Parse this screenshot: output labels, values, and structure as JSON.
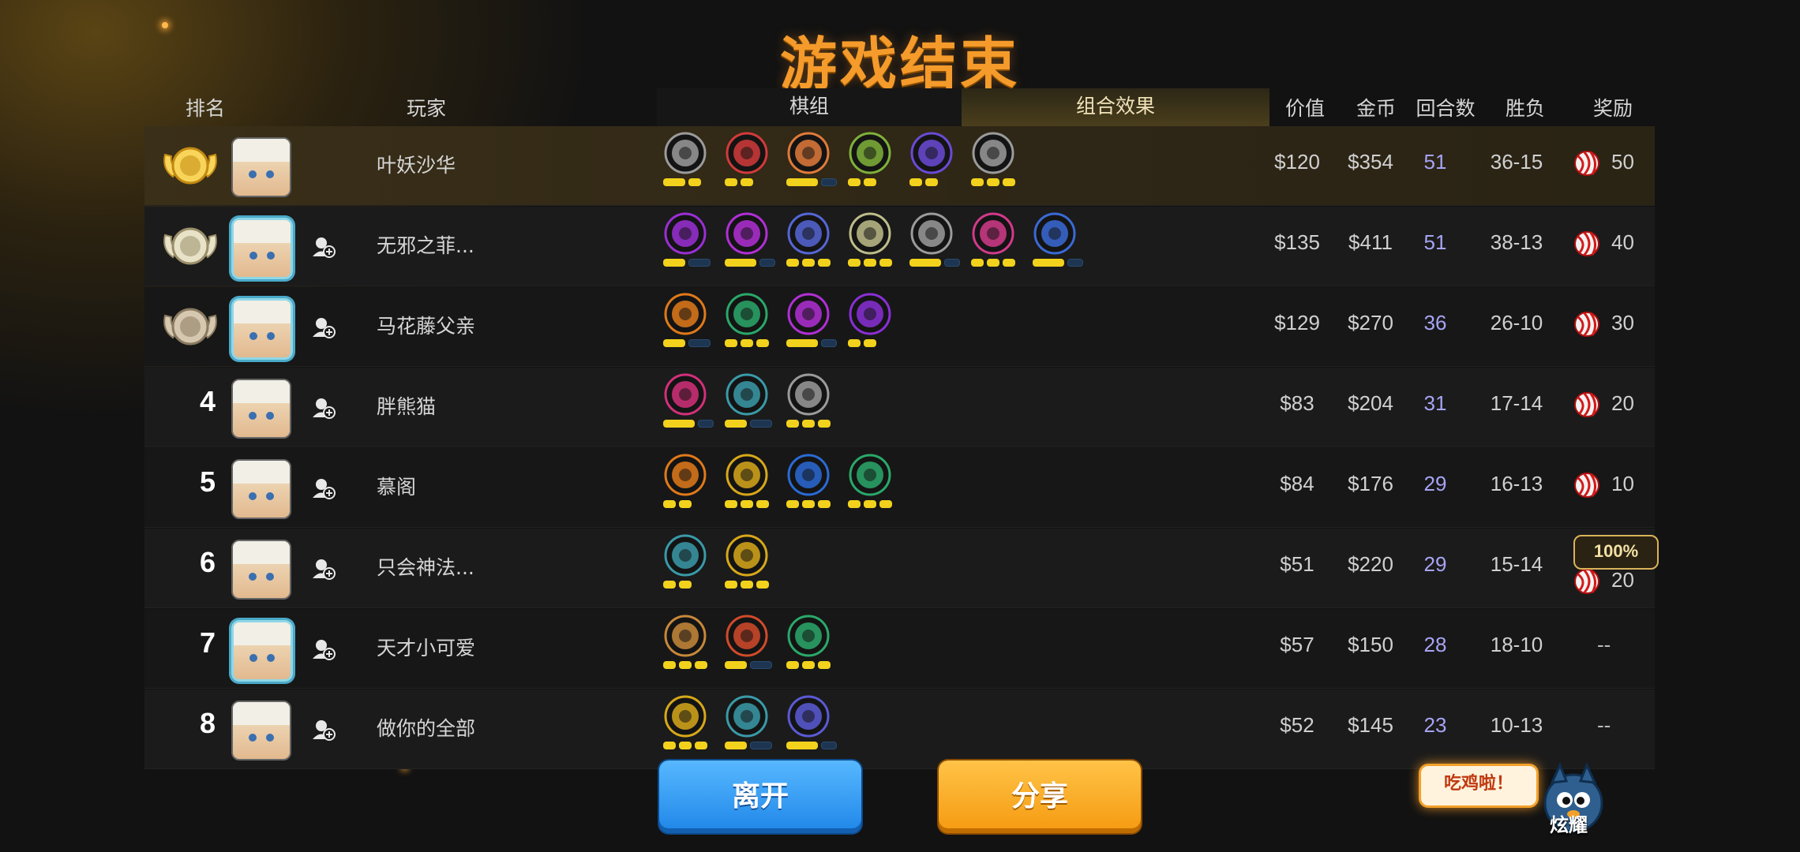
{
  "title": "游戏结束",
  "headers": {
    "rank": "排名",
    "player": "玩家",
    "lineup": "棋组",
    "synergy": "组合效果",
    "value": "价值",
    "gold": "金币",
    "rounds": "回合数",
    "record": "胜负",
    "reward": "奖励"
  },
  "players": [
    {
      "rank": "",
      "medal": "gold",
      "name": "叶妖沙华",
      "value": "$120",
      "gold": "$354",
      "rounds": "51",
      "record": "36-15",
      "reward": "50",
      "bonus": "",
      "units": [
        {
          "color": "#9b9b9b",
          "stars": [
            2,
            1
          ]
        },
        {
          "color": "#d23a3a",
          "stars": [
            1,
            1
          ]
        },
        {
          "color": "#e07a3a",
          "stars": [
            3,
            0
          ]
        },
        {
          "color": "#7fb13a",
          "stars": [
            1,
            1
          ]
        },
        {
          "color": "#6a4ad6",
          "stars": [
            1,
            1
          ]
        },
        {
          "color": "#9b9b9b",
          "stars": [
            1,
            1,
            1
          ]
        }
      ]
    },
    {
      "rank": "",
      "medal": "silver",
      "name": "无邪之菲...",
      "value": "$135",
      "gold": "$411",
      "rounds": "51",
      "record": "38-13",
      "reward": "40",
      "bonus": "",
      "units": [
        {
          "color": "#9b2fd6",
          "stars": [
            2,
            0
          ]
        },
        {
          "color": "#b12fd6",
          "stars": [
            3,
            0
          ]
        },
        {
          "color": "#5566d6",
          "stars": [
            1,
            1,
            1
          ]
        },
        {
          "color": "#bdbd8a",
          "stars": [
            1,
            1,
            1
          ]
        },
        {
          "color": "#9b9b9b",
          "stars": [
            3,
            0
          ]
        },
        {
          "color": "#d23a8a",
          "stars": [
            1,
            1,
            1
          ]
        },
        {
          "color": "#3a6ad6",
          "stars": [
            3,
            0
          ]
        }
      ]
    },
    {
      "rank": "",
      "medal": "bronze",
      "name": "马花藤父亲",
      "value": "$129",
      "gold": "$270",
      "rounds": "36",
      "record": "26-10",
      "reward": "30",
      "bonus": "",
      "units": [
        {
          "color": "#e07a1a",
          "stars": [
            2,
            0
          ]
        },
        {
          "color": "#2aa86a",
          "stars": [
            1,
            1,
            1
          ]
        },
        {
          "color": "#b12fd6",
          "stars": [
            3,
            0
          ]
        },
        {
          "color": "#8a2fd6",
          "stars": [
            1,
            1
          ]
        }
      ]
    },
    {
      "rank": "4",
      "medal": "",
      "name": "胖熊猫",
      "value": "$83",
      "gold": "$204",
      "rounds": "31",
      "record": "17-14",
      "reward": "20",
      "bonus": "",
      "units": [
        {
          "color": "#d2307a",
          "stars": [
            3,
            0
          ]
        },
        {
          "color": "#3a9aa8",
          "stars": [
            2,
            0
          ]
        },
        {
          "color": "#9b9b9b",
          "stars": [
            1,
            1,
            1
          ]
        }
      ]
    },
    {
      "rank": "5",
      "medal": "",
      "name": "慕阁",
      "value": "$84",
      "gold": "$176",
      "rounds": "29",
      "record": "16-13",
      "reward": "10",
      "bonus": "",
      "units": [
        {
          "color": "#e07a1a",
          "stars": [
            1,
            1
          ]
        },
        {
          "color": "#d8a81a",
          "stars": [
            1,
            1,
            1
          ]
        },
        {
          "color": "#2a6ad6",
          "stars": [
            1,
            1,
            1
          ]
        },
        {
          "color": "#2aa86a",
          "stars": [
            1,
            1,
            1
          ]
        }
      ]
    },
    {
      "rank": "6",
      "medal": "",
      "name": "只会神法...",
      "value": "$51",
      "gold": "$220",
      "rounds": "29",
      "record": "15-14",
      "reward": "20",
      "bonus": "100%",
      "units": [
        {
          "color": "#3a9aa8",
          "stars": [
            1,
            1
          ]
        },
        {
          "color": "#d8a81a",
          "stars": [
            1,
            1,
            1
          ]
        }
      ]
    },
    {
      "rank": "7",
      "medal": "",
      "name": "天才小可爱",
      "value": "$57",
      "gold": "$150",
      "rounds": "28",
      "record": "18-10",
      "reward": "--",
      "bonus": "",
      "units": [
        {
          "color": "#c8883a",
          "stars": [
            1,
            1,
            1
          ]
        },
        {
          "color": "#d24a2a",
          "stars": [
            2,
            0
          ]
        },
        {
          "color": "#2aa86a",
          "stars": [
            1,
            1,
            1
          ]
        }
      ]
    },
    {
      "rank": "8",
      "medal": "",
      "name": "做你的全部",
      "value": "$52",
      "gold": "$145",
      "rounds": "23",
      "record": "10-13",
      "reward": "--",
      "bonus": "",
      "units": [
        {
          "color": "#d8a81a",
          "stars": [
            1,
            1,
            1
          ]
        },
        {
          "color": "#3a9aa8",
          "stars": [
            2,
            0
          ]
        },
        {
          "color": "#5a5ad6",
          "stars": [
            3,
            0
          ]
        }
      ]
    }
  ],
  "buttons": {
    "leave": "离开",
    "share": "分享"
  },
  "bubble": "吃鸡啦！",
  "mascot_label": "炫耀"
}
